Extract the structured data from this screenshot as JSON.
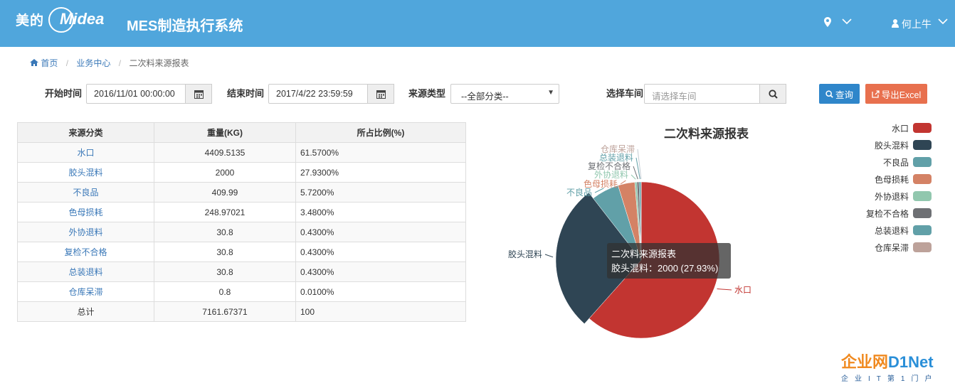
{
  "header": {
    "brand_cn": "美的",
    "brand_en": "Midea",
    "system_title": "MES制造执行系统",
    "location_icon": "map-marker-icon",
    "user_name": "何上牛",
    "colors": {
      "bar": "#50a6dc"
    }
  },
  "breadcrumb": {
    "home": "首页",
    "section": "业务中心",
    "current": "二次料来源报表"
  },
  "filters": {
    "start_label": "开始时间",
    "start_value": "2016/11/01 00:00:00",
    "end_label": "结束时间",
    "end_value": "2017/4/22 23:59:59",
    "type_label": "来源类型",
    "type_value": "--全部分类--",
    "workshop_label": "选择车间",
    "workshop_placeholder": "请选择车间",
    "query_label": "查询",
    "export_label": "导出Excel"
  },
  "table": {
    "headers": [
      "来源分类",
      "重量(KG)",
      "所占比例(%)"
    ],
    "rows": [
      [
        "水口",
        "4409.5135",
        "61.5700%"
      ],
      [
        "胶头混料",
        "2000",
        "27.9300%"
      ],
      [
        "不良品",
        "409.99",
        "5.7200%"
      ],
      [
        "色母损耗",
        "248.97021",
        "3.4800%"
      ],
      [
        "外协退料",
        "30.8",
        "0.4300%"
      ],
      [
        "复检不合格",
        "30.8",
        "0.4300%"
      ],
      [
        "总装退料",
        "30.8",
        "0.4300%"
      ],
      [
        "仓库呆滞",
        "0.8",
        "0.0100%"
      ]
    ],
    "total": [
      "总计",
      "7161.67371",
      "100"
    ]
  },
  "chart_data": {
    "type": "pie",
    "title": "二次料来源报表",
    "categories": [
      "水口",
      "胶头混料",
      "不良品",
      "色母损耗",
      "外协退料",
      "复检不合格",
      "总装退料",
      "仓库呆滞"
    ],
    "values": [
      4409.5135,
      2000,
      409.99,
      248.97021,
      30.8,
      30.8,
      30.8,
      0.8
    ],
    "colors": [
      "#c23531",
      "#2f4554",
      "#61a0a8",
      "#d48265",
      "#91c7ae",
      "#6e7074",
      "#61a0a8",
      "#c4ccd3"
    ],
    "legend_colors": [
      "#c23531",
      "#2f4554",
      "#61a0a8",
      "#d48265",
      "#91c7ae",
      "#6e7074",
      "#61a0a8",
      "#bda29a"
    ],
    "legend_position": "right",
    "tooltip": {
      "title": "二次料来源报表",
      "text": "胶头混料：2000 (27.93%)"
    }
  },
  "watermark": {
    "main": "企业网",
    "accent": "D1Net",
    "sub": "企业IT第1门户"
  }
}
